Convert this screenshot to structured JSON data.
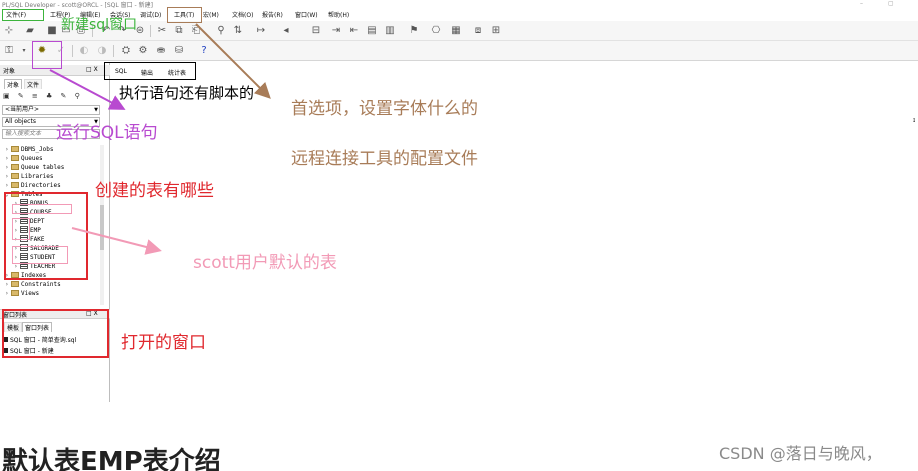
{
  "window": {
    "title": "PL/SQL Developer - scott@ORCL - [SQL 窗口 - 新建]",
    "controls": [
      "–",
      "▢"
    ]
  },
  "menu": [
    "文件(F)",
    "工程(P)",
    "编辑(E)",
    "会话(S)",
    "调试(D)",
    "工具(T)",
    "宏(M)",
    "文档(O)",
    "报告(R)",
    "窗口(W)",
    "帮助(H)"
  ],
  "left_panel": {
    "header": "对象",
    "header_controls": "□ X",
    "tabs": [
      "对象",
      "文件"
    ],
    "toolbar_icons": "▣ ✎ ≡ ♣ ✎ ⚲",
    "user_filter": "<当前用户>",
    "type_filter": "All objects",
    "find_placeholder": "输入搜索文本",
    "tree": [
      {
        "label": "DBMS_Jobs",
        "expanded": false
      },
      {
        "label": "Queues",
        "expanded": false
      },
      {
        "label": "Queue tables",
        "expanded": false
      },
      {
        "label": "Libraries",
        "expanded": false
      },
      {
        "label": "Directories",
        "expanded": false
      },
      {
        "label": "Tables",
        "expanded": true
      },
      {
        "label": "BONUS",
        "table": true
      },
      {
        "label": "COURSE",
        "table": true
      },
      {
        "label": "DEPT",
        "table": true
      },
      {
        "label": "EMP",
        "table": true
      },
      {
        "label": "FAKE",
        "table": true
      },
      {
        "label": "SALGRADE",
        "table": true
      },
      {
        "label": "STUDENT",
        "table": true
      },
      {
        "label": "TEACHER",
        "table": true
      },
      {
        "label": "Indexes",
        "expanded": false
      },
      {
        "label": "Constraints",
        "expanded": false
      },
      {
        "label": "Views",
        "expanded": false
      }
    ]
  },
  "window_list": {
    "header": "窗口列表",
    "header_controls": "□ X",
    "tabs": [
      "模板",
      "窗口列表"
    ],
    "items": [
      "SQL 窗口 - 简单查询.sql",
      "SQL 窗口 - 新建"
    ]
  },
  "main": {
    "tabs": [
      "SQL",
      "输出",
      "统计表"
    ]
  },
  "annotations": {
    "new_sql_window": "新建sql窗口",
    "run_sql": "运行SQL语句",
    "exec_statement": "执行语句还有脚本的",
    "preferences": "首选项，设置字体什么的",
    "remote_config": "远程连接工具的配置文件",
    "created_tables": "创建的表有哪些",
    "scott_tables": "scott用户默认的表",
    "open_windows": "打开的窗口",
    "right_mark": "ɪ"
  },
  "colors": {
    "green": "#3cb43c",
    "purple": "#b84ad0",
    "brown": "#a87c58",
    "red": "#e0282e",
    "pink": "#f29ab6",
    "black": "#000000"
  },
  "footer": {
    "title": "默认表EMP表介绍",
    "watermark": "CSDN @落日与晚风，"
  }
}
